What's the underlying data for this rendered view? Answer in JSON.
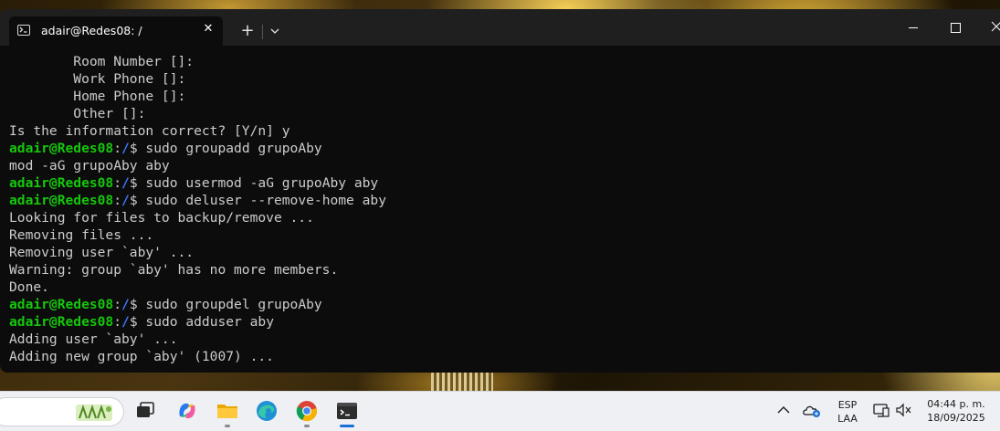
{
  "terminal": {
    "tab_title": "adair@Redes08: /",
    "new_tab_symbol": "+",
    "close_symbol": "✕",
    "lines": [
      {
        "text": "        Room Number []:"
      },
      {
        "text": "        Work Phone []:"
      },
      {
        "text": "        Home Phone []:"
      },
      {
        "text": "        Other []:"
      },
      {
        "text": "Is the information correct? [Y/n] y"
      },
      {
        "prompt_user": "adair@Redes08",
        "prompt_sep": ":",
        "prompt_path": "/",
        "prompt_end": "$ ",
        "command": "sudo groupadd grupoAby"
      },
      {
        "text": "mod -aG grupoAby aby"
      },
      {
        "prompt_user": "adair@Redes08",
        "prompt_sep": ":",
        "prompt_path": "/",
        "prompt_end": "$ ",
        "command": "sudo usermod -aG grupoAby aby"
      },
      {
        "prompt_user": "adair@Redes08",
        "prompt_sep": ":",
        "prompt_path": "/",
        "prompt_end": "$ ",
        "command": "sudo deluser --remove-home aby"
      },
      {
        "text": "Looking for files to backup/remove ..."
      },
      {
        "text": "Removing files ..."
      },
      {
        "text": "Removing user `aby' ..."
      },
      {
        "text": "Warning: group `aby' has no more members."
      },
      {
        "text": "Done."
      },
      {
        "prompt_user": "adair@Redes08",
        "prompt_sep": ":",
        "prompt_path": "/",
        "prompt_end": "$ ",
        "command": "sudo groupdel grupoAby"
      },
      {
        "prompt_user": "adair@Redes08",
        "prompt_sep": ":",
        "prompt_path": "/",
        "prompt_end": "$ ",
        "command": "sudo adduser aby"
      },
      {
        "text": "Adding user `aby' ..."
      },
      {
        "text": "Adding new group `aby' (1007) ..."
      }
    ]
  },
  "taskbar": {
    "apps": [
      {
        "name": "task-view",
        "active": false
      },
      {
        "name": "copilot",
        "active": false
      },
      {
        "name": "file-explorer",
        "active": true
      },
      {
        "name": "edge",
        "active": false
      },
      {
        "name": "chrome",
        "active": true
      },
      {
        "name": "terminal",
        "active": true
      }
    ],
    "language": "ESP",
    "keyboard_layout": "LAA",
    "time": "04:44 p. m.",
    "date": "18/09/2025"
  },
  "colors": {
    "prompt_user": "#16c60c",
    "prompt_path": "#3b78ff",
    "terminal_bg": "#0c0c0c",
    "terminal_fg": "#cccccc"
  }
}
